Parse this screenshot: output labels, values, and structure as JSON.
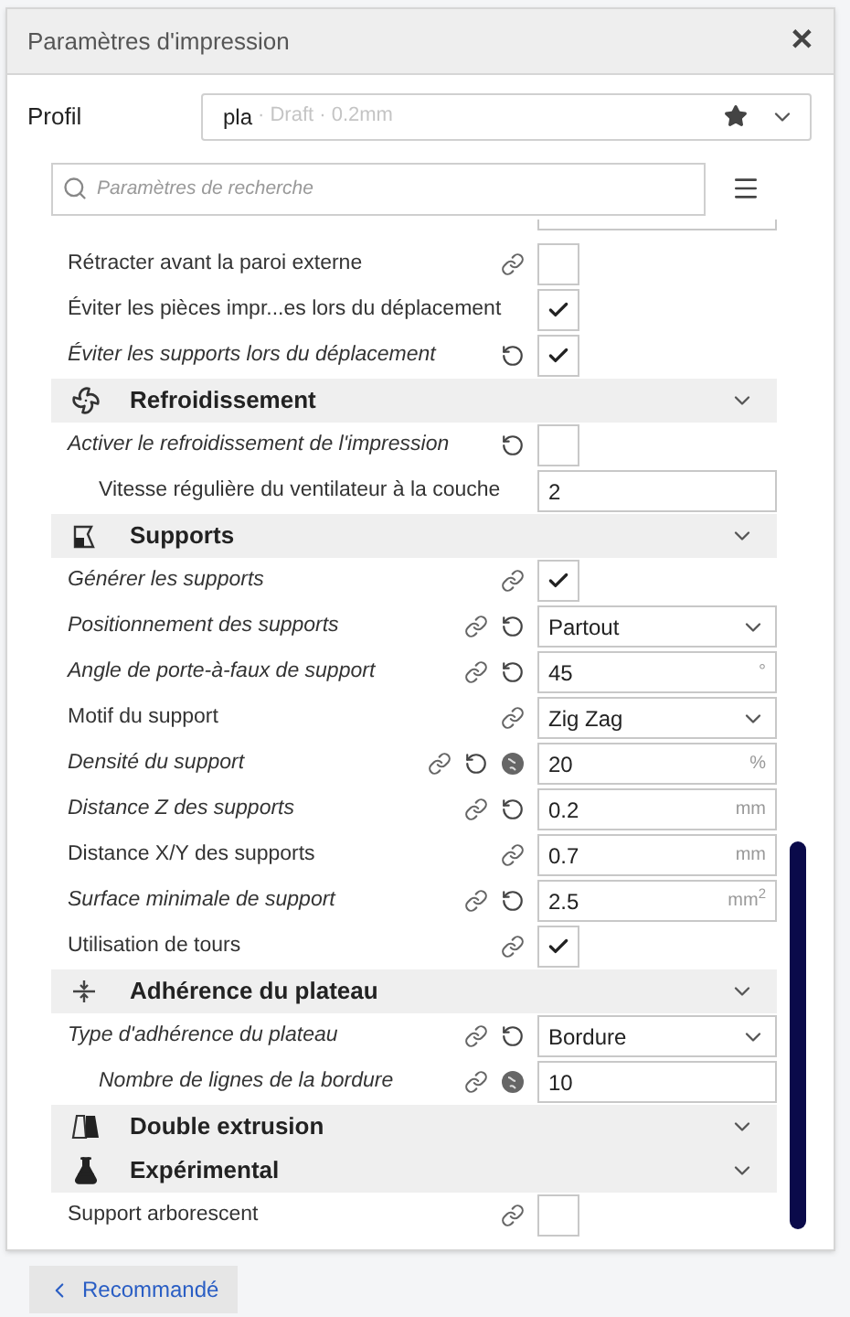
{
  "window": {
    "title": "Paramètres d'impression",
    "close": "✕"
  },
  "profile": {
    "label": "Profil",
    "name": "pla",
    "detail": "· Draft · 0.2mm"
  },
  "search": {
    "placeholder": "Paramètres de recherche"
  },
  "settings_top": [
    {
      "kind": "checkbox",
      "label": "Rétracter avant la paroi externe",
      "modified": false,
      "linked": true,
      "reset": false,
      "inherited": false,
      "checked": false
    },
    {
      "kind": "checkbox",
      "label": "Éviter les pièces impr...es lors du déplacement",
      "modified": false,
      "linked": false,
      "reset": false,
      "inherited": false,
      "checked": true
    },
    {
      "kind": "checkbox",
      "label": "Éviter les supports lors du déplacement",
      "modified": true,
      "linked": false,
      "reset": true,
      "inherited": false,
      "checked": true
    }
  ],
  "categories": [
    {
      "title": "Refroidissement",
      "settings": [
        {
          "kind": "checkbox",
          "label": "Activer le refroidissement de l'impression",
          "modified": true,
          "linked": false,
          "reset": true,
          "inherited": false,
          "checked": false,
          "children": [
            {
              "kind": "number",
              "label": "Vitesse régulière du ventilateur à la couche",
              "modified": false,
              "linked": false,
              "reset": false,
              "inherited": false,
              "value": "2"
            }
          ]
        }
      ]
    },
    {
      "title": "Supports",
      "settings": [
        {
          "kind": "checkbox",
          "label": "Générer les supports",
          "modified": true,
          "linked": true,
          "reset": false,
          "inherited": false,
          "checked": true
        },
        {
          "kind": "select",
          "label": "Positionnement des supports",
          "modified": true,
          "linked": true,
          "reset": true,
          "inherited": false,
          "value": "Partout"
        },
        {
          "kind": "number",
          "label": "Angle de porte-à-faux de support",
          "modified": true,
          "linked": true,
          "reset": true,
          "inherited": false,
          "value": "45",
          "unit": "°"
        },
        {
          "kind": "select",
          "label": "Motif du support",
          "modified": false,
          "linked": true,
          "reset": false,
          "inherited": false,
          "value": "Zig Zag"
        },
        {
          "kind": "number",
          "label": "Densité du support",
          "modified": true,
          "linked": true,
          "reset": true,
          "inherited": true,
          "value": "20",
          "unit": "%"
        },
        {
          "kind": "number",
          "label": "Distance Z des supports",
          "modified": true,
          "linked": true,
          "reset": true,
          "inherited": false,
          "value": "0.2",
          "unit": "mm"
        },
        {
          "kind": "number",
          "label": "Distance X/Y des supports",
          "modified": false,
          "linked": true,
          "reset": false,
          "inherited": false,
          "value": "0.7",
          "unit": "mm"
        },
        {
          "kind": "number",
          "label": "Surface minimale de support",
          "modified": true,
          "linked": true,
          "reset": true,
          "inherited": false,
          "value": "2.5",
          "unit": "mm$^{2}$"
        },
        {
          "kind": "checkbox",
          "label": "Utilisation de tours",
          "modified": false,
          "linked": true,
          "reset": false,
          "inherited": false,
          "checked": true
        }
      ]
    },
    {
      "title": "Adhérence du plateau",
      "settings": [
        {
          "kind": "select",
          "label": "Type d'adhérence du plateau",
          "modified": true,
          "linked": true,
          "reset": true,
          "inherited": false,
          "value": "Bordure",
          "children": [
            {
              "kind": "number",
              "label": "Nombre de lignes de la bordure",
              "modified": true,
              "linked": true,
              "reset": false,
              "inherited": true,
              "value": "10"
            }
          ]
        }
      ]
    },
    {
      "title": "Double extrusion"
    },
    {
      "title": "Expérimental",
      "settings": [
        {
          "kind": "checkbox",
          "label": "Support arborescent",
          "modified": false,
          "linked": true,
          "reset": false,
          "inherited": false,
          "checked": false
        }
      ]
    }
  ],
  "footer": {
    "button": "Recommandé"
  }
}
